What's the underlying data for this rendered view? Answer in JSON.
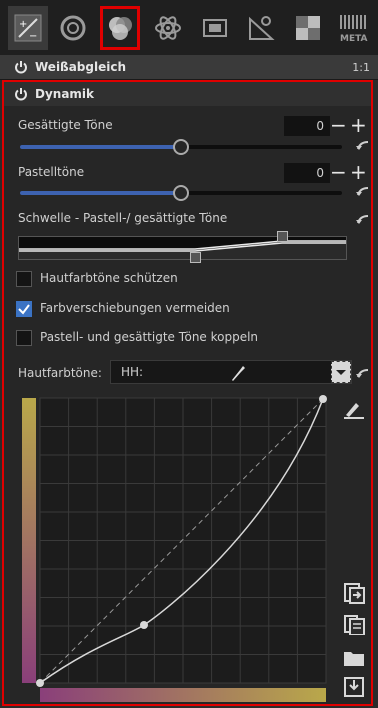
{
  "toolbar": {
    "icons": [
      {
        "name": "exposure-icon",
        "selected": false
      },
      {
        "name": "details-icon",
        "selected": false
      },
      {
        "name": "color-icon",
        "selected": true
      },
      {
        "name": "advanced-icon",
        "selected": false
      },
      {
        "name": "transform-icon",
        "selected": false
      },
      {
        "name": "raw-icon",
        "selected": false
      },
      {
        "name": "mask-icon",
        "selected": false
      },
      {
        "name": "metadata-icon",
        "selected": false,
        "label": "META"
      }
    ]
  },
  "white_balance": {
    "title": "Weißabgleich",
    "ratio": "1:1"
  },
  "vibrance": {
    "title": "Dynamik",
    "saturated": {
      "label": "Gesättigte Töne",
      "value": "0",
      "level": 0.5
    },
    "pastel": {
      "label": "Pastelltöne",
      "value": "0",
      "level": 0.5
    },
    "threshold": {
      "label": "Schwelle - Pastell-/ gesättigte Töne"
    },
    "checkboxes": [
      {
        "label": "Hautfarbtöne schützen",
        "checked": false
      },
      {
        "label": "Farbverschiebungen vermeiden",
        "checked": true
      },
      {
        "label": "Pastell- und gesättigte Töne koppeln",
        "checked": false
      }
    ],
    "skin_tones": {
      "label": "Hautfarbtöne:",
      "value": "HH:"
    }
  },
  "colors": {
    "accent": "#e00000",
    "slider_fill": "#3d62b0",
    "checkbox_checked": "#3b73c4"
  }
}
